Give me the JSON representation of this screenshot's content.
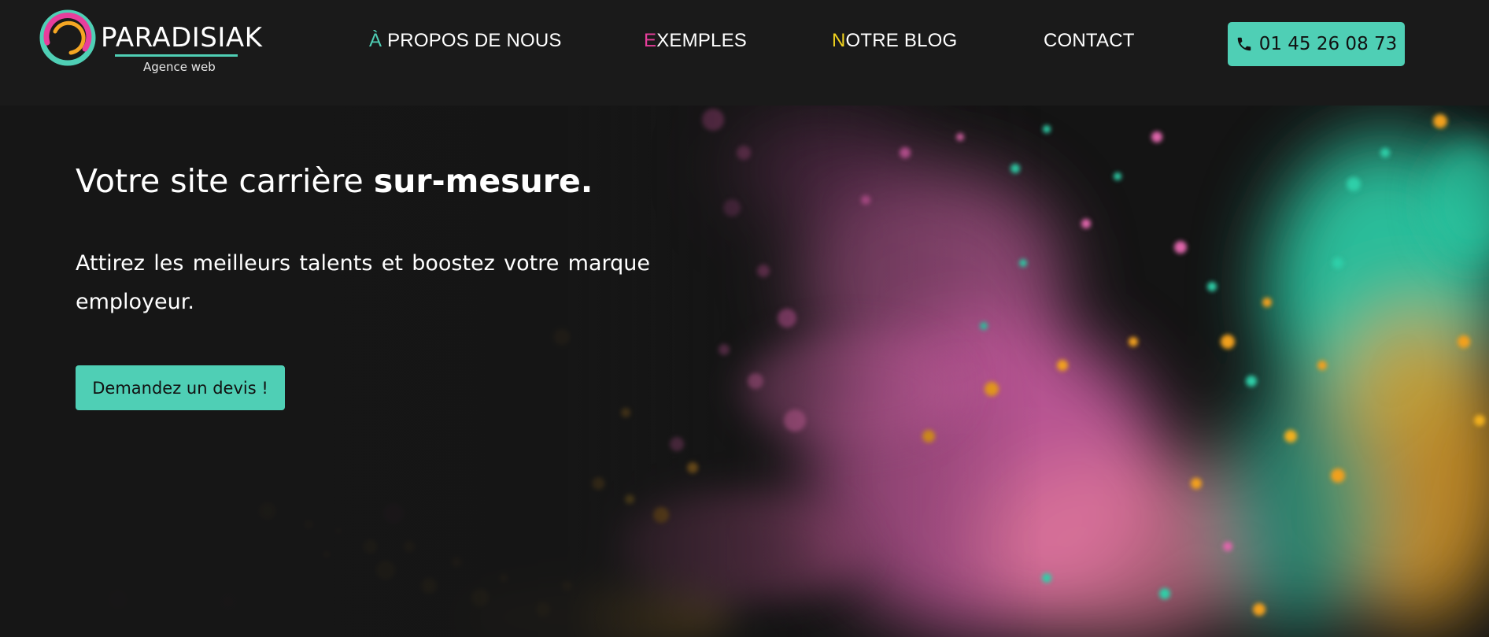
{
  "header": {
    "logo": {
      "name": "PARADISIAK",
      "tagline": "Agence web"
    },
    "nav": [
      {
        "initial": "À",
        "rest": " PROPOS DE NOUS",
        "accent": "#4fcfb5"
      },
      {
        "initial": "E",
        "rest": "XEMPLES",
        "accent": "#e83e9c"
      },
      {
        "initial": "N",
        "rest": "OTRE BLOG",
        "accent": "#f0d21e"
      },
      {
        "initial": "",
        "rest": "CONTACT",
        "accent": "#ffffff"
      }
    ],
    "phone": {
      "icon": "phone-icon",
      "number": "01 45 26 08 73"
    }
  },
  "hero": {
    "title_regular": "Votre site carrière ",
    "title_bold": "sur-mesure.",
    "subtitle": "Attirez les meilleurs talents et boostez votre marque employeur.",
    "cta_label": "Demandez un devis !"
  },
  "colors": {
    "accent": "#4fcfb5",
    "pink": "#e83e9c",
    "yellow": "#f0d21e",
    "orange": "#f5a623",
    "background": "#181818"
  }
}
